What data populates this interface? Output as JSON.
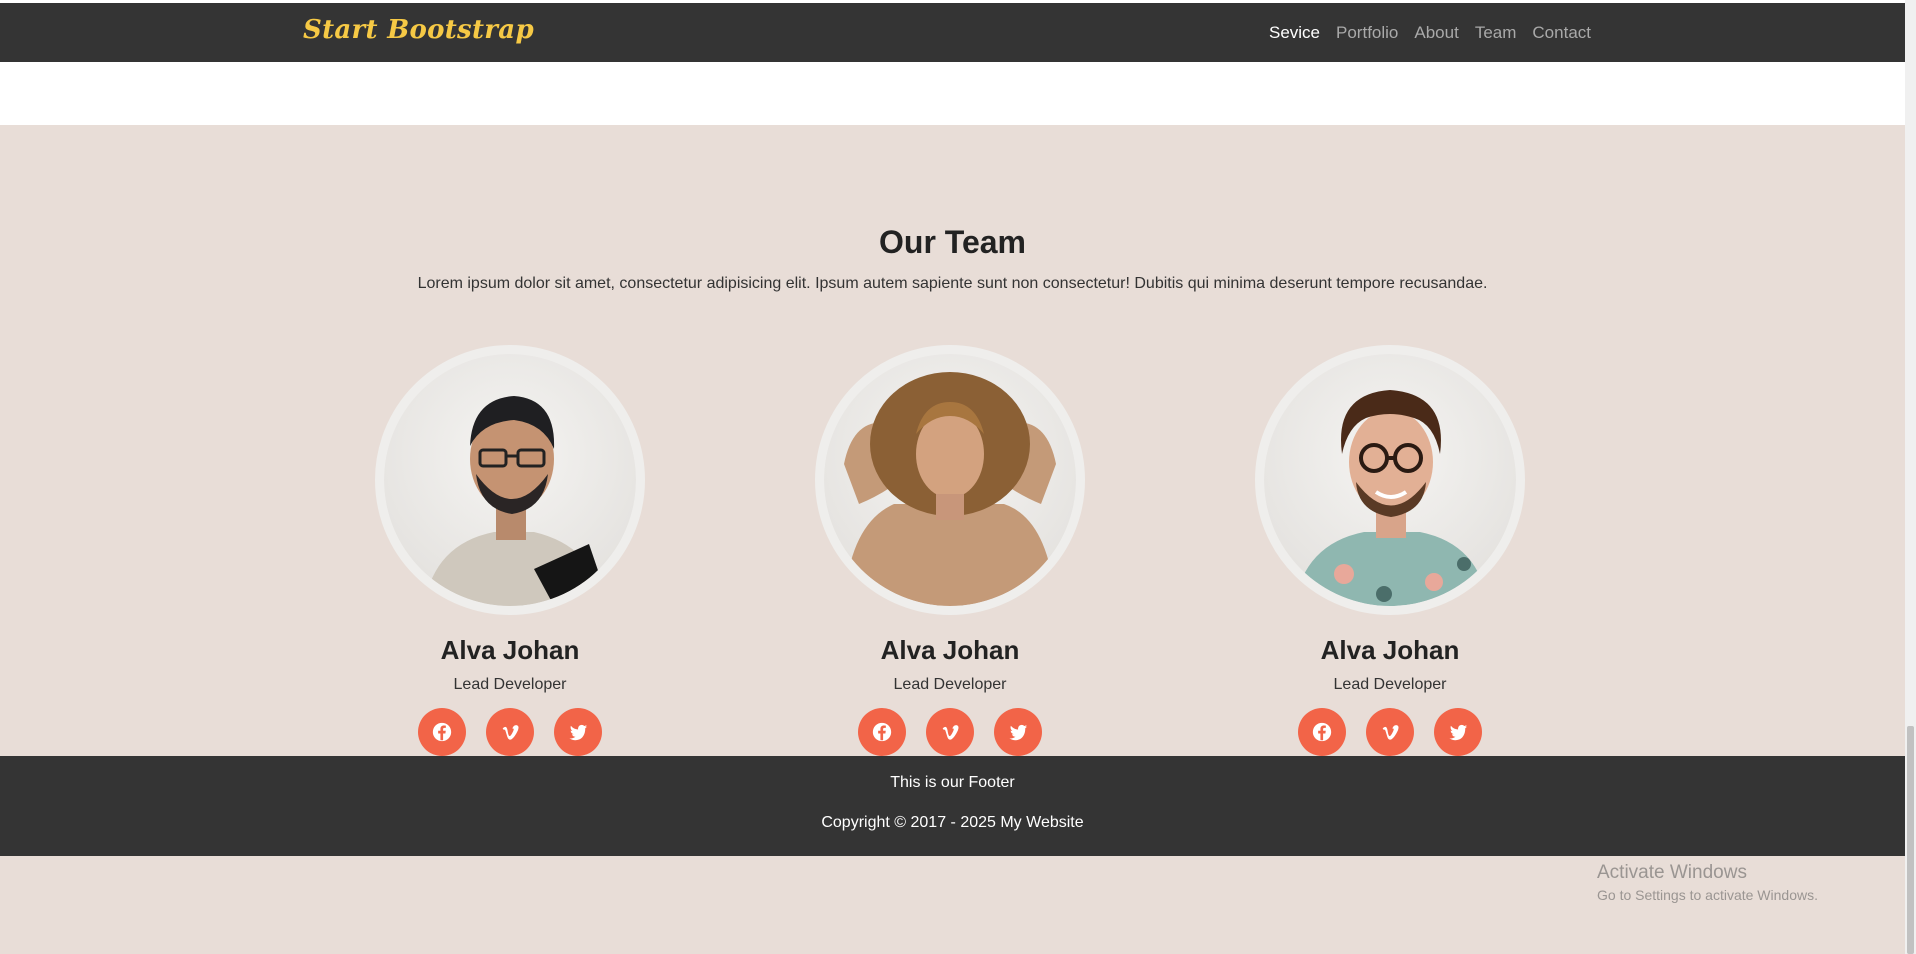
{
  "nav": {
    "brand": "Start Bootstrap",
    "links": [
      "Sevice",
      "Portfolio",
      "About",
      "Team",
      "Contact"
    ],
    "active": "Sevice"
  },
  "team": {
    "title": "Our Team",
    "description": "Lorem ipsum dolor sit amet, consectetur adipisicing elit. Ipsum autem sapiente sunt non consectetur! Dubitis qui minima deserunt tempore recusandae.",
    "members": [
      {
        "name": "Alva Johan",
        "role": "Lead Developer",
        "socials": [
          "facebook-icon",
          "vimeo-icon",
          "twitter-icon"
        ]
      },
      {
        "name": "Alva Johan",
        "role": "Lead Developer",
        "socials": [
          "facebook-icon",
          "vimeo-icon",
          "twitter-icon"
        ]
      },
      {
        "name": "Alva Johan",
        "role": "Lead Developer",
        "socials": [
          "facebook-icon",
          "vimeo-icon",
          "twitter-icon"
        ]
      }
    ]
  },
  "footer": {
    "line1": "This is our Footer",
    "line2": "Copyright © 2017 - 2025 My Website"
  },
  "windows_watermark": {
    "title": "Activate Windows",
    "subtitle": "Go to Settings to activate Windows."
  },
  "colors": {
    "navbar": "#343434",
    "brand": "#f6c945",
    "section_bg": "#e8ddd7",
    "social_button": "#f26448"
  }
}
